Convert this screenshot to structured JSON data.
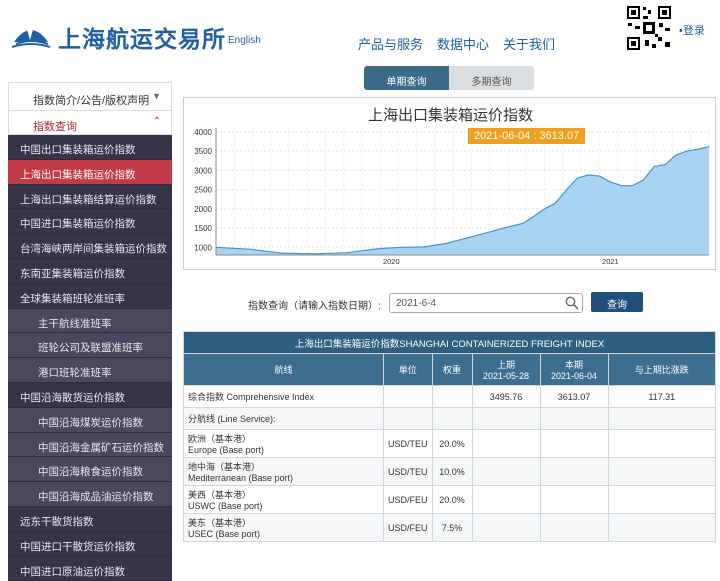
{
  "header": {
    "logo_cn": "上海航运交易所",
    "logo_en": "English",
    "nav": [
      "产品与服务",
      "数据中心",
      "关于我们"
    ],
    "login": "•登录"
  },
  "sidebar": {
    "top1": "指数简介/公告/版权声明",
    "top2": "指数查询",
    "items": [
      {
        "label": "中国出口集装箱运价指数",
        "sub": false,
        "active": false
      },
      {
        "label": "上海出口集装箱运价指数",
        "sub": false,
        "active": true
      },
      {
        "label": "上海出口集装箱结算运价指数",
        "sub": false,
        "active": false
      },
      {
        "label": "中国进口集装箱运价指数",
        "sub": false,
        "active": false
      },
      {
        "label": "台湾海峡两岸间集装箱运价指数",
        "sub": false,
        "active": false
      },
      {
        "label": "东南亚集装箱运价指数",
        "sub": false,
        "active": false
      },
      {
        "label": "全球集装箱班轮准班率",
        "sub": false,
        "active": false
      },
      {
        "label": "主干航线准班率",
        "sub": true,
        "active": false
      },
      {
        "label": "班轮公司及联盟准班率",
        "sub": true,
        "active": false
      },
      {
        "label": "港口班轮准班率",
        "sub": true,
        "active": false
      },
      {
        "label": "中国沿海散货运价指数",
        "sub": false,
        "active": false
      },
      {
        "label": "中国沿海煤炭运价指数",
        "sub": true,
        "active": false
      },
      {
        "label": "中国沿海金属矿石运价指数",
        "sub": true,
        "active": false
      },
      {
        "label": "中国沿海粮食运价指数",
        "sub": true,
        "active": false
      },
      {
        "label": "中国沿海成品油运价指数",
        "sub": true,
        "active": false
      },
      {
        "label": "远东干散货指数",
        "sub": false,
        "active": false
      },
      {
        "label": "中国进口干散货运价指数",
        "sub": false,
        "active": false
      },
      {
        "label": "中国进口原油运价指数",
        "sub": false,
        "active": false
      }
    ]
  },
  "tabs": [
    "单期查询",
    "多期查询"
  ],
  "chart_data": {
    "type": "area",
    "title": "上海出口集装箱运价指数",
    "tooltip": "2021-06-04 : 3613.07",
    "yticks": [
      "4000",
      "3500",
      "3000",
      "2500",
      "2000",
      "1500",
      "1000"
    ],
    "ylim": [
      800,
      4100
    ],
    "xticks": [
      "2020",
      "2021"
    ],
    "x_years": [
      2020,
      2021
    ],
    "x_range": [
      2019.2,
      2021.45
    ],
    "x": [
      2019.2,
      2019.35,
      2019.5,
      2019.65,
      2019.8,
      2019.95,
      2020.05,
      2020.15,
      2020.25,
      2020.35,
      2020.45,
      2020.5,
      2020.55,
      2020.6,
      2020.65,
      2020.7,
      2020.75,
      2020.8,
      2020.85,
      2020.9,
      2020.95,
      2021.0,
      2021.05,
      2021.1,
      2021.15,
      2021.2,
      2021.25,
      2021.3,
      2021.35,
      2021.4,
      2021.45
    ],
    "y": [
      1000,
      950,
      850,
      830,
      860,
      970,
      1000,
      1010,
      1100,
      1250,
      1400,
      1480,
      1550,
      1620,
      1800,
      2000,
      2150,
      2500,
      2800,
      2880,
      2850,
      2700,
      2600,
      2600,
      2750,
      3100,
      3150,
      3400,
      3500,
      3550,
      3613.07
    ],
    "fill": "#a9d3f2",
    "line": "#4a92d0"
  },
  "query": {
    "label": "指数查询（请输入指数日期）:",
    "value": "2021-6-4",
    "button": "查询"
  },
  "table": {
    "caption": "上海出口集装箱运价指数SHANGHAI CONTAINERIZED FREIGHT INDEX",
    "headers": [
      "航线",
      "单位",
      "权重",
      "上期\n2021-05-28",
      "本期\n2021-06-04",
      "与上期比涨跌"
    ],
    "rows": [
      {
        "route": "综合指数 Comprehensive Index",
        "unit": "",
        "weight": "",
        "prev": "3495.76",
        "curr": "3613.07",
        "change": "117.31"
      },
      {
        "route": "分航线 (Line Service):",
        "unit": "",
        "weight": "",
        "prev": "",
        "curr": "",
        "change": ""
      },
      {
        "route": "欧洲（基本港）\nEurope (Base port)",
        "unit": "USD/TEU",
        "weight": "20.0%",
        "prev": "",
        "curr": "",
        "change": ""
      },
      {
        "route": "地中海（基本港）\nMediterranean (Base port)",
        "unit": "USD/TEU",
        "weight": "10.0%",
        "prev": "",
        "curr": "",
        "change": ""
      },
      {
        "route": "美西（基本港）\nUSWC (Base port)",
        "unit": "USD/FEU",
        "weight": "20.0%",
        "prev": "",
        "curr": "",
        "change": ""
      },
      {
        "route": "美东（基本港）\nUSEC (Base port)",
        "unit": "USD/FEU",
        "weight": "7.5%",
        "prev": "",
        "curr": "",
        "change": ""
      }
    ]
  }
}
